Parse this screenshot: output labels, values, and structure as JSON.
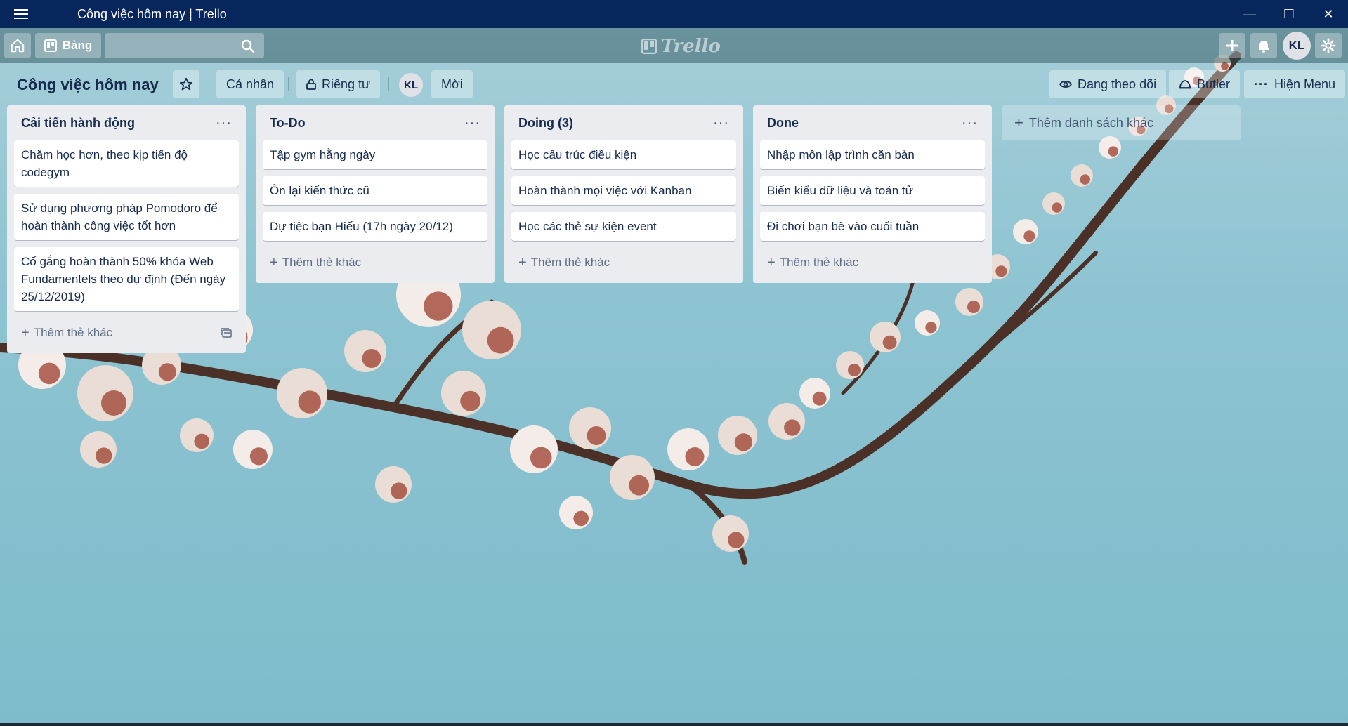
{
  "window": {
    "title": "Công việc hôm nay | Trello",
    "minimize": "—",
    "maximize": "☐",
    "close": "✕"
  },
  "header": {
    "boards_label": "Bảng",
    "search_value": "",
    "logo_text": "Trello",
    "avatar_initials": "KL"
  },
  "board": {
    "title": "Công việc hôm nay",
    "visibility_team": "Cá nhân",
    "visibility_privacy": "Riêng tư",
    "member_initials": "KL",
    "invite_label": "Mời",
    "watch_label": "Đang theo dõi",
    "butler_label": "Butler",
    "menu_label": "Hiện Menu"
  },
  "lists": [
    {
      "title": "Cải tiến hành động",
      "cards": [
        "Chăm học hơn, theo kịp tiến độ codegym",
        "Sử dụng phương pháp Pomodoro để hoàn thành công việc tốt hơn",
        "Cố gắng hoàn thành 50% khóa Web Fundamentels theo dự định (Đến ngày 25/12/2019)"
      ],
      "add_label": "Thêm thẻ khác"
    },
    {
      "title": "To-Do",
      "cards": [
        "Tập gym hằng ngày",
        "Ôn lại kiến thức cũ",
        "Dự tiệc bạn Hiếu (17h ngày 20/12)"
      ],
      "add_label": "Thêm thẻ khác"
    },
    {
      "title": "Doing (3)",
      "cards": [
        "Học cấu trúc điều kiện",
        "Hoàn thành mọi việc với Kanban",
        "Học các thẻ sự kiện event"
      ],
      "add_label": "Thêm thẻ khác"
    },
    {
      "title": "Done",
      "cards": [
        "Nhập môn lập trình căn bản",
        "Biến kiểu dữ liệu và toán tử",
        "Đi chơi bạn bè vào cuối tuần"
      ],
      "add_label": "Thêm thẻ khác"
    }
  ],
  "add_list_label": "Thêm danh sách khác",
  "colors": {
    "titlebar": "#07275c",
    "list_bg": "#ebecf0",
    "text": "#172b4d"
  }
}
